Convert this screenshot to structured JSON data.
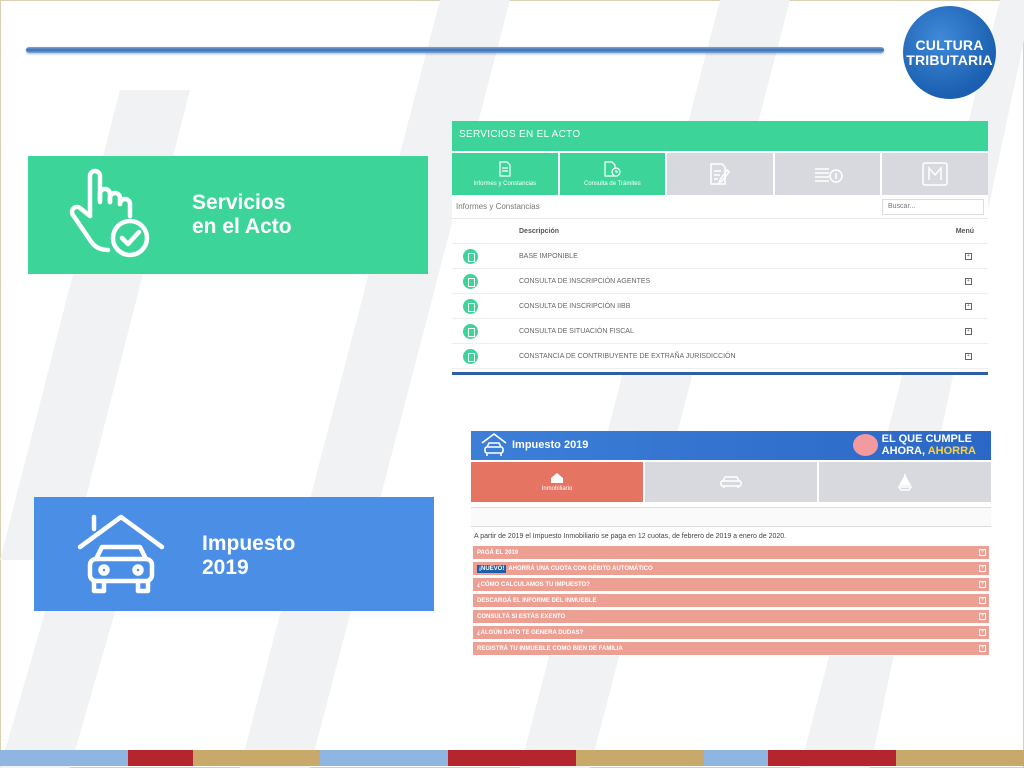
{
  "logo": {
    "line1": "CULTURA",
    "line2": "TRIBUTARIA",
    "color": "#1b5fb0"
  },
  "tiles": {
    "servicios": {
      "line1": "Servicios",
      "line2": "en el Acto",
      "color": "#3dd49a",
      "icon": "hand-pointer-check-icon"
    },
    "impuesto": {
      "line1": "Impuesto",
      "line2": "2019",
      "color": "#4a8ee6",
      "icon": "house-car-icon"
    }
  },
  "panel1": {
    "header": "SERVICIOS EN EL ACTO",
    "tabs": [
      {
        "label": "Informes y Constancias",
        "icon": "document-icon",
        "active": true
      },
      {
        "label": "Consulta de Trámites",
        "icon": "document-clock-icon",
        "active": true
      },
      {
        "label": "",
        "icon": "document-edit-icon",
        "active": false
      },
      {
        "label": "",
        "icon": "coins-icon",
        "active": false
      },
      {
        "label": "",
        "icon": "m-letter-icon",
        "active": false
      }
    ],
    "subtitle": "Informes y Constancias",
    "search_placeholder": "Buscar...",
    "columns": {
      "desc": "Descripción",
      "menu": "Menú"
    },
    "rows": [
      "BASE IMPONIBLE",
      "CONSULTA DE INSCRIPCIÓN AGENTES",
      "CONSULTA DE INSCRIPCIÓN IIBB",
      "CONSULTA DE SITUACIÓN FISCAL",
      "CONSTANCIA DE CONTRIBUYENTE DE EXTRAÑA JURISDICCIÓN"
    ],
    "accent": "#3dd49a"
  },
  "panel2": {
    "title": "Impuesto 2019",
    "slogan1": "EL QUE CUMPLE",
    "slogan2a": "AHORA, ",
    "slogan2b": "AHORRA",
    "tabs": [
      {
        "label": "Inmobiliario",
        "icon": "house-icon",
        "active": true
      },
      {
        "label": "",
        "icon": "car-icon",
        "active": false
      },
      {
        "label": "",
        "icon": "boat-icon",
        "active": false
      }
    ],
    "intro": "A partir de 2019 el Impuesto Inmobiliario se paga en 12 cuotas, de febrero de 2019 a enero de 2020.",
    "badge": "¡NUEVO!",
    "items": [
      "PAGÁ EL 2019",
      "AHORRÁ UNA CUOTA CON DÉBITO AUTOMÁTICO",
      "¿CÓMO CALCULAMOS TU IMPUESTO?",
      "DESCARGÁ EL INFORME DEL INMUEBLE",
      "CONSULTÁ SI ESTÁS EXENTO",
      "¿ALGÚN DATO TE GENERA DUDAS?",
      "REGISTRÁ TU INMUEBLE COMO BIEN DE FAMILIA"
    ],
    "accent": "#e57462"
  },
  "strip_colors": [
    "#8fb6e0",
    "#b5252e",
    "#c9a96a",
    "#8fb6e0",
    "#b5252e",
    "#c9a96a",
    "#8fb6e0",
    "#b5252e",
    "#c9a96a"
  ]
}
